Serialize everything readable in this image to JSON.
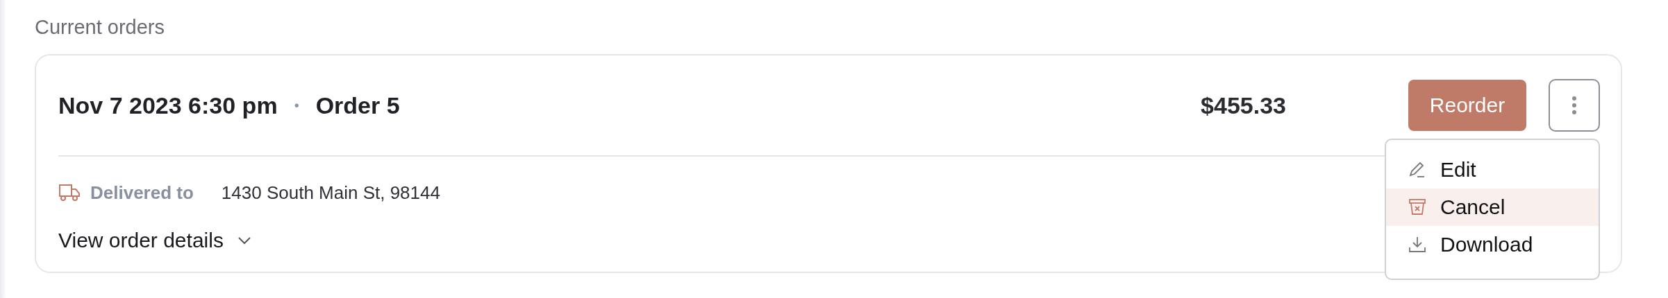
{
  "section_title": "Current orders",
  "order": {
    "date": "Nov 7 2023 6:30 pm",
    "separator": "•",
    "number": "Order 5",
    "total": "$455.33",
    "reorder_button": "Reorder",
    "delivered_label": "Delivered to",
    "address": "1430 South Main St, 98144",
    "details_link": "View order details",
    "details_expanded": false
  },
  "menu": {
    "open": true,
    "items": [
      {
        "label": "Edit",
        "kind": "edit",
        "selected": false
      },
      {
        "label": "Cancel",
        "kind": "cancel",
        "selected": true
      },
      {
        "label": "Download",
        "kind": "download",
        "selected": false
      }
    ]
  }
}
